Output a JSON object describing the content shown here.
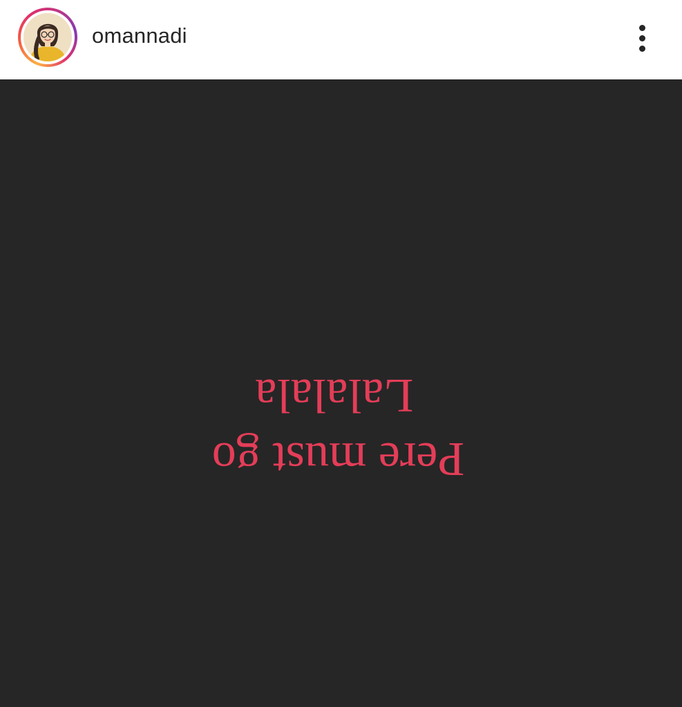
{
  "post": {
    "username": "omannadi",
    "more_icon": "more-vertical-icon",
    "avatar_icon": "profile-avatar",
    "image": {
      "background_color": "#262626",
      "text_color": "#e43d58",
      "orientation": "upside-down",
      "lines": [
        "Pere must go",
        "Lalalala"
      ]
    }
  }
}
